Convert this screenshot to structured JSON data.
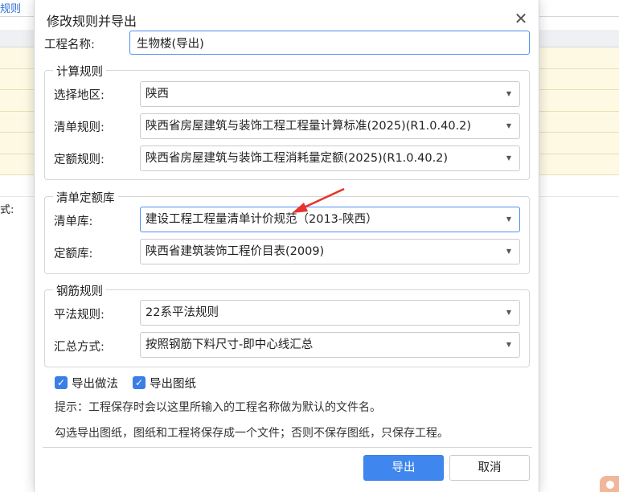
{
  "background": {
    "tab_label": "规则",
    "side_label": "式:"
  },
  "dialog": {
    "title": "修改规则并导出",
    "close_glyph": "✕",
    "project_name_label": "工程名称:",
    "project_name_value": "生物楼(导出)",
    "calc_rules": {
      "title": "计算规则",
      "region_label": "选择地区:",
      "region_value": "陕西",
      "list_rule_label": "清单规则:",
      "list_rule_value": "陕西省房屋建筑与装饰工程工程量计算标准(2025)(R1.0.40.2)",
      "quota_rule_label": "定额规则:",
      "quota_rule_value": "陕西省房屋建筑与装饰工程消耗量定额(2025)(R1.0.40.2)"
    },
    "libraries": {
      "title": "清单定额库",
      "list_lib_label": "清单库:",
      "list_lib_value": "建设工程工程量清单计价规范（2013-陕西）",
      "quota_lib_label": "定额库:",
      "quota_lib_value": "陕西省建筑装饰工程价目表(2009)"
    },
    "rebar_rules": {
      "title": "钢筋规则",
      "flat_rule_label": "平法规则:",
      "flat_rule_value": "22系平法规则",
      "summary_label": "汇总方式:",
      "summary_value": "按照钢筋下料尺寸-即中心线汇总"
    },
    "checkboxes": {
      "export_method_label": "导出做法",
      "export_method_checked": true,
      "export_drawing_label": "导出图纸",
      "export_drawing_checked": true
    },
    "hint1": "提示：工程保存时会以这里所输入的工程名称做为默认的文件名。",
    "hint2": "勾选导出图纸，图纸和工程将保存成一个文件；否则不保存图纸，只保存工程。",
    "ok_label": "导出",
    "cancel_label": "取消"
  },
  "colors": {
    "accent": "#3f87ee",
    "annotation_arrow": "#e8322c",
    "row_highlight": "#fdf9e3"
  },
  "icons": {
    "dropdown": "triangle-down-icon",
    "check": "check-icon",
    "close": "close-icon",
    "annotation": "red-arrow-icon"
  }
}
